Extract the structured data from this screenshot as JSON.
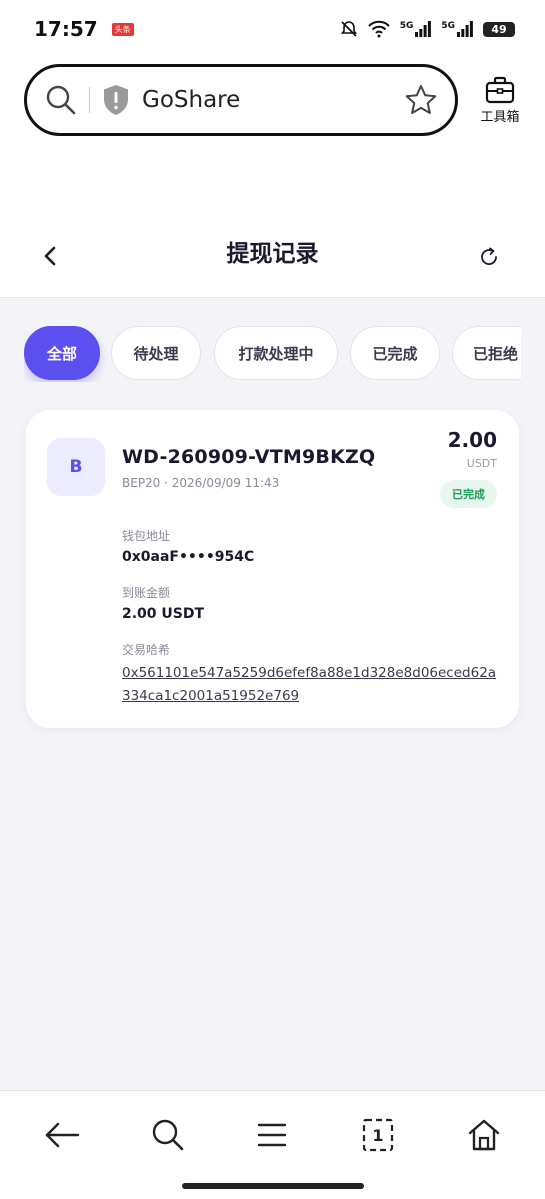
{
  "status_bar": {
    "time": "17:57",
    "badge": "头条",
    "signal_1": "5G",
    "signal_2": "5G",
    "battery": "49"
  },
  "browser": {
    "url_text": "GoShare",
    "toolbox_label": "工具箱"
  },
  "header": {
    "title": "提现记录"
  },
  "tabs": [
    {
      "label": "全部",
      "active": true
    },
    {
      "label": "待处理",
      "active": false
    },
    {
      "label": "打款处理中",
      "active": false
    },
    {
      "label": "已完成",
      "active": false
    },
    {
      "label": "已拒绝",
      "active": false
    }
  ],
  "record": {
    "avatar_letter": "B",
    "id": "WD-260909-VTM9BKZQ",
    "meta": "BEP20 · 2026/09/09 11:43",
    "amount": "2.00",
    "unit": "USDT",
    "status": "已完成",
    "wallet_label": "钱包地址",
    "wallet_value": "0x0aaF••••954C",
    "received_label": "到账金额",
    "received_value": "2.00 USDT",
    "hash_label": "交易哈希",
    "hash_value": "0x561101e547a5259d6efef8a88e1d328e8d06eced62a334ca1c2001a51952e769"
  },
  "colors": {
    "accent": "#5b4ff0",
    "status_green": "#1f9a55",
    "status_green_bg": "#e7f7ee",
    "background": "#f4f4f8"
  },
  "icons": {
    "search": "search-icon",
    "shield": "shield-icon",
    "star": "star-icon",
    "toolbox": "toolbox-icon",
    "back": "chevron-left-icon",
    "refresh": "refresh-icon",
    "nav_back": "arrow-left-icon",
    "nav_search": "search-icon",
    "nav_menu": "menu-icon",
    "nav_tabs": "tabs-icon",
    "nav_home": "home-icon"
  },
  "bottom_nav": {
    "tab_count": "1"
  }
}
